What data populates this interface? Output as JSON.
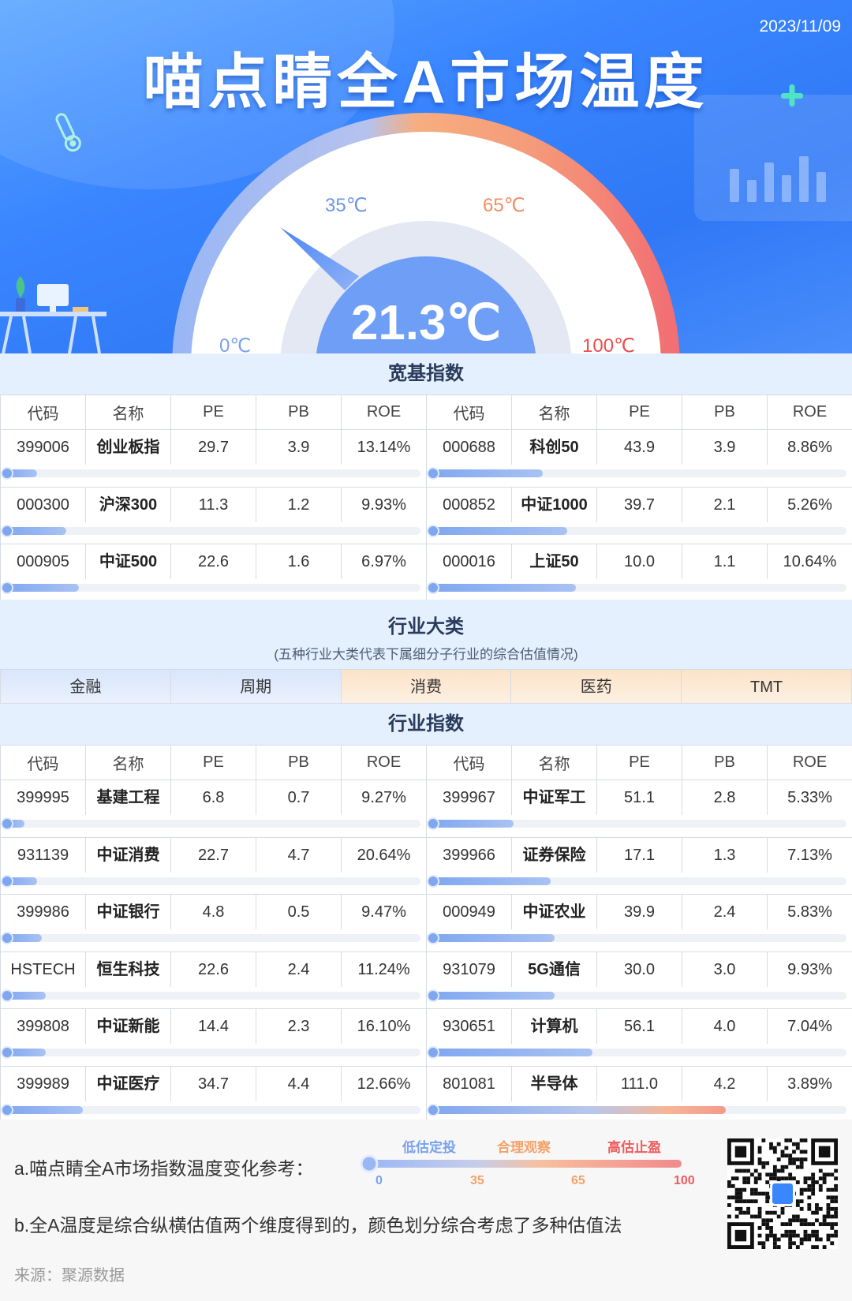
{
  "header": {
    "date": "2023/11/09",
    "title": "喵点睛全A市场温度",
    "gauge": {
      "value": 21.3,
      "value_text": "21.3℃",
      "ticks": [
        "0℃",
        "35℃",
        "65℃",
        "100℃"
      ],
      "colors": {
        "cool": "#9ab7f5",
        "mid": "#f6ae7f",
        "hot": "#f26f73"
      }
    }
  },
  "broad": {
    "title": "宽基指数",
    "headers": [
      "代码",
      "名称",
      "PE",
      "PB",
      "ROE",
      "代码",
      "名称",
      "PE",
      "PB",
      "ROE"
    ],
    "rows": [
      [
        {
          "code": "399006",
          "name": "创业板指",
          "pe": "29.7",
          "pb": "3.9",
          "roe": "13.14%",
          "temp": 8
        },
        {
          "code": "000688",
          "name": "科创50",
          "pe": "43.9",
          "pb": "3.9",
          "roe": "8.86%",
          "temp": 27
        }
      ],
      [
        {
          "code": "000300",
          "name": "沪深300",
          "pe": "11.3",
          "pb": "1.2",
          "roe": "9.93%",
          "temp": 15
        },
        {
          "code": "000852",
          "name": "中证1000",
          "pe": "39.7",
          "pb": "2.1",
          "roe": "5.26%",
          "temp": 33
        }
      ],
      [
        {
          "code": "000905",
          "name": "中证500",
          "pe": "22.6",
          "pb": "1.6",
          "roe": "6.97%",
          "temp": 18
        },
        {
          "code": "000016",
          "name": "上证50",
          "pe": "10.0",
          "pb": "1.1",
          "roe": "10.64%",
          "temp": 35
        }
      ]
    ]
  },
  "sector_classes": {
    "title": "行业大类",
    "subtitle": "(五种行业大类代表下属细分子行业的综合估值情况)",
    "items": [
      {
        "label": "金融",
        "tone": "cool"
      },
      {
        "label": "周期",
        "tone": "cool"
      },
      {
        "label": "消费",
        "tone": "warm"
      },
      {
        "label": "医药",
        "tone": "warm"
      },
      {
        "label": "TMT",
        "tone": "warm"
      }
    ]
  },
  "sectors": {
    "title": "行业指数",
    "headers": [
      "代码",
      "名称",
      "PE",
      "PB",
      "ROE",
      "代码",
      "名称",
      "PE",
      "PB",
      "ROE"
    ],
    "rows": [
      [
        {
          "code": "399995",
          "name": "基建工程",
          "pe": "6.8",
          "pb": "0.7",
          "roe": "9.27%",
          "temp": 5
        },
        {
          "code": "399967",
          "name": "中证军工",
          "pe": "51.1",
          "pb": "2.8",
          "roe": "5.33%",
          "temp": 20
        }
      ],
      [
        {
          "code": "931139",
          "name": "中证消费",
          "pe": "22.7",
          "pb": "4.7",
          "roe": "20.64%",
          "temp": 8
        },
        {
          "code": "399966",
          "name": "证券保险",
          "pe": "17.1",
          "pb": "1.3",
          "roe": "7.13%",
          "temp": 29
        }
      ],
      [
        {
          "code": "399986",
          "name": "中证银行",
          "pe": "4.8",
          "pb": "0.5",
          "roe": "9.47%",
          "temp": 9
        },
        {
          "code": "000949",
          "name": "中证农业",
          "pe": "39.9",
          "pb": "2.4",
          "roe": "5.83%",
          "temp": 30
        }
      ],
      [
        {
          "code": "HSTECH",
          "name": "恒生科技",
          "pe": "22.6",
          "pb": "2.4",
          "roe": "11.24%",
          "temp": 10
        },
        {
          "code": "931079",
          "name": "5G通信",
          "pe": "30.0",
          "pb": "3.0",
          "roe": "9.93%",
          "temp": 30
        }
      ],
      [
        {
          "code": "399808",
          "name": "中证新能",
          "pe": "14.4",
          "pb": "2.3",
          "roe": "16.10%",
          "temp": 10
        },
        {
          "code": "930651",
          "name": "计算机",
          "pe": "56.1",
          "pb": "4.0",
          "roe": "7.04%",
          "temp": 39
        }
      ],
      [
        {
          "code": "399989",
          "name": "中证医疗",
          "pe": "34.7",
          "pb": "4.4",
          "roe": "12.66%",
          "temp": 19
        },
        {
          "code": "801081",
          "name": "半导体",
          "pe": "111.0",
          "pb": "4.2",
          "roe": "3.89%",
          "temp": 71
        }
      ]
    ]
  },
  "footer": {
    "note_a": "a.喵点睛全A市场指数温度变化参考：",
    "note_b": "b.全A温度是综合纵横估值两个维度得到的，颜色划分综合考虑了多种估值法",
    "source": "来源：聚源数据",
    "scale": {
      "labels": [
        "低估定投",
        "合理观察",
        "高估止盈"
      ],
      "label_colors": [
        "#7aa1ee",
        "#f4a26a",
        "#ee5b5b"
      ],
      "numbers": [
        "0",
        "35",
        "65",
        "100"
      ],
      "number_colors": [
        "#7aa1ee",
        "#f4a26a",
        "#f4a26a",
        "#ee5b5b"
      ]
    }
  }
}
